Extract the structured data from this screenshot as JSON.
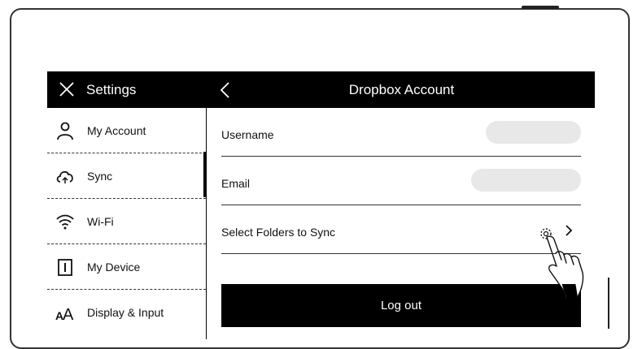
{
  "topbar": {
    "settings_title": "Settings",
    "page_title": "Dropbox Account"
  },
  "sidebar": {
    "items": [
      {
        "label": "My Account",
        "icon": "person-icon"
      },
      {
        "label": "Sync",
        "icon": "cloud-sync-icon",
        "active": true
      },
      {
        "label": "Wi-Fi",
        "icon": "wifi-icon"
      },
      {
        "label": "My Device",
        "icon": "device-icon"
      },
      {
        "label": "Display & Input",
        "icon": "font-size-icon"
      }
    ]
  },
  "account": {
    "username_label": "Username",
    "email_label": "Email",
    "select_folders_label": "Select Folders to Sync",
    "logout_label": "Log out"
  },
  "colors": {
    "bar": "#000000",
    "pill": "#e8e8e8"
  }
}
